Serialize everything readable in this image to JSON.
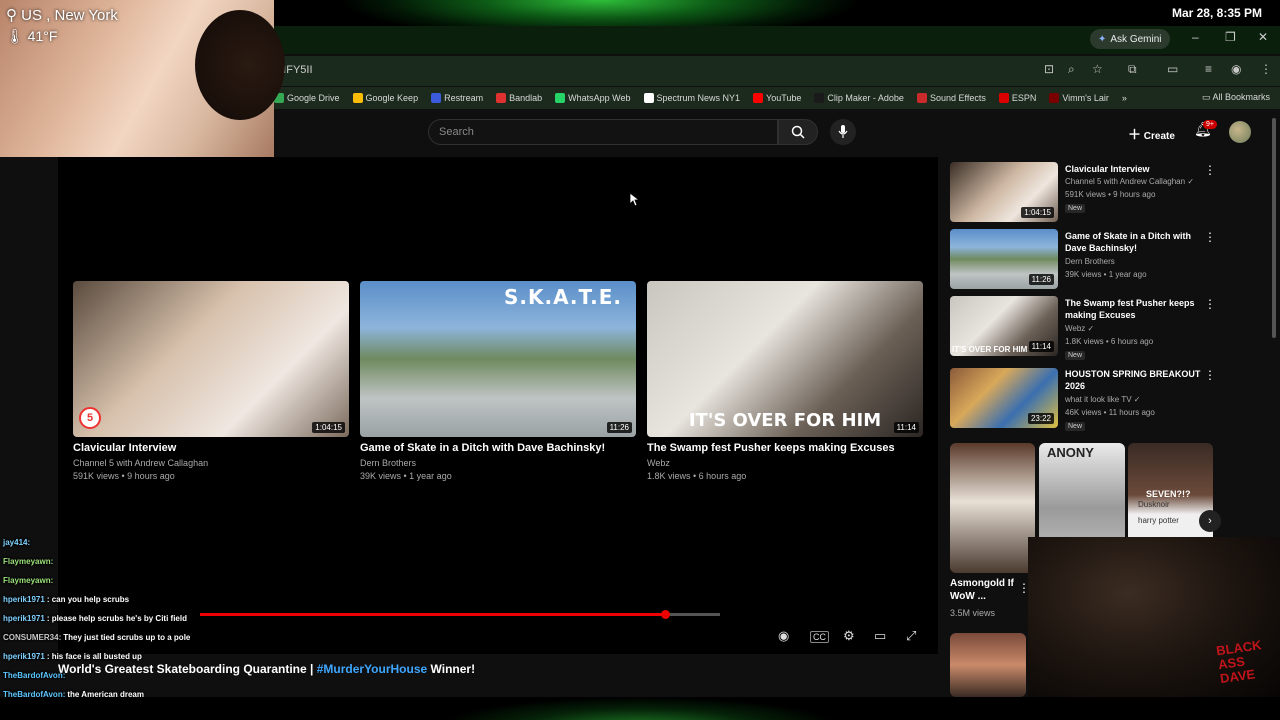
{
  "desktop": {
    "clock": "Mar 28, 8:35 PM"
  },
  "webcam": {
    "location": "US , New York",
    "temperature": "41°F"
  },
  "browser": {
    "ask_gemini": "Ask Gemini",
    "address": "MIFY5II",
    "bookmarks": [
      {
        "label": "Google Drive",
        "color": "#34a853"
      },
      {
        "label": "Google Keep",
        "color": "#fbbc04"
      },
      {
        "label": "Restream",
        "color": "#3b5bdb"
      },
      {
        "label": "Bandlab",
        "color": "#e03131"
      },
      {
        "label": "WhatsApp Web",
        "color": "#25d366"
      },
      {
        "label": "Spectrum News NY1",
        "color": "#ffffff"
      },
      {
        "label": "YouTube",
        "color": "#ff0000"
      },
      {
        "label": "Clip Maker - Adobe",
        "color": "#1a1a1a"
      },
      {
        "label": "Sound Effects",
        "color": "#c92a2a"
      },
      {
        "label": "ESPN",
        "color": "#d00"
      },
      {
        "label": "Vimm's Lair",
        "color": "#7a0000"
      }
    ],
    "all_bookmarks": "All Bookmarks"
  },
  "youtube": {
    "search_placeholder": "Search",
    "create_label": "Create",
    "notification_count": "9+"
  },
  "endscreen": [
    {
      "title": "Clavicular Interview",
      "channel": "Channel 5 with Andrew Callaghan",
      "meta": "591K views • 9 hours ago",
      "duration": "1:04:15"
    },
    {
      "title": "Game of Skate in a Ditch with Dave Bachinsky!",
      "channel": "Dern Brothers",
      "meta": "39K views • 1 year ago",
      "duration": "11:26",
      "overlay": "S.K.A.T.E."
    },
    {
      "title": "The Swamp fest Pusher keeps making Excuses",
      "channel": "Webz",
      "meta": "1.8K views • 6 hours ago",
      "duration": "11:14",
      "overlay": "IT'S OVER FOR HIM"
    }
  ],
  "player": {
    "progress": 0.895,
    "buffered": 1.0
  },
  "video_title": {
    "prefix": "World's Greatest Skateboarding Quarantine | ",
    "hashtag": "#MurderYourHouse",
    "suffix": " Winner!"
  },
  "chat": [
    {
      "user": "jay414:",
      "msg": "",
      "color": "#7fd1ff"
    },
    {
      "user": "Flaymeyawn:",
      "msg": "",
      "color": "#9be37a"
    },
    {
      "user": "Flaymeyawn:",
      "msg": "",
      "color": "#9be37a"
    },
    {
      "user": "hperik1971",
      "msg": ": can you help scrubs",
      "color": "#7fd1ff"
    },
    {
      "user": "hperik1971",
      "msg": ": please help scrubs he's by Citi field",
      "color": "#7fd1ff"
    },
    {
      "user": "CONSUMER34:",
      "msg": " They just tied scrubs up to a pole",
      "color": "#c8c8c8"
    },
    {
      "user": "hperik1971",
      "msg": ": his face is all busted up",
      "color": "#7fd1ff"
    },
    {
      "user": "TheBardofAvon:",
      "msg": "",
      "color": "#5dc6ff"
    },
    {
      "user": "TheBardofAvon:",
      "msg": " the American dream",
      "color": "#5dc6ff"
    },
    {
      "user": "TheBardofAvon:",
      "msg": "",
      "color": "#5dc6ff"
    }
  ],
  "sidebar": [
    {
      "title": "Clavicular Interview",
      "channel": "Channel 5 with Andrew Callaghan",
      "meta": "591K views • 9 hours ago",
      "badge": "New",
      "duration": "1:04:15"
    },
    {
      "title": "Game of Skate in a Ditch with Dave Bachinsky!",
      "channel": "Dern Brothers",
      "meta": "39K views • 1 year ago",
      "badge": "",
      "duration": "11:26"
    },
    {
      "title": "The Swamp fest Pusher keeps making Excuses",
      "channel": "Webz",
      "meta": "1.8K views • 6 hours ago",
      "badge": "New",
      "duration": "11:14",
      "overlay": "IT'S OVER FOR HIM"
    },
    {
      "title": "HOUSTON SPRING BREAKOUT 2026",
      "channel": "what it look like TV",
      "meta": "46K views • 11 hours ago",
      "badge": "New",
      "duration": "23:22"
    }
  ],
  "shorts": {
    "title": "Asmongold If WoW ...",
    "views": "3.5M views",
    "overlay_anony": "ANONY",
    "overlay_seven": "SEVEN?!?",
    "overlay_names": [
      "Dusknoir",
      "harry potter"
    ]
  },
  "webcam2": {
    "logo": "BLACK ASS DAVE"
  }
}
